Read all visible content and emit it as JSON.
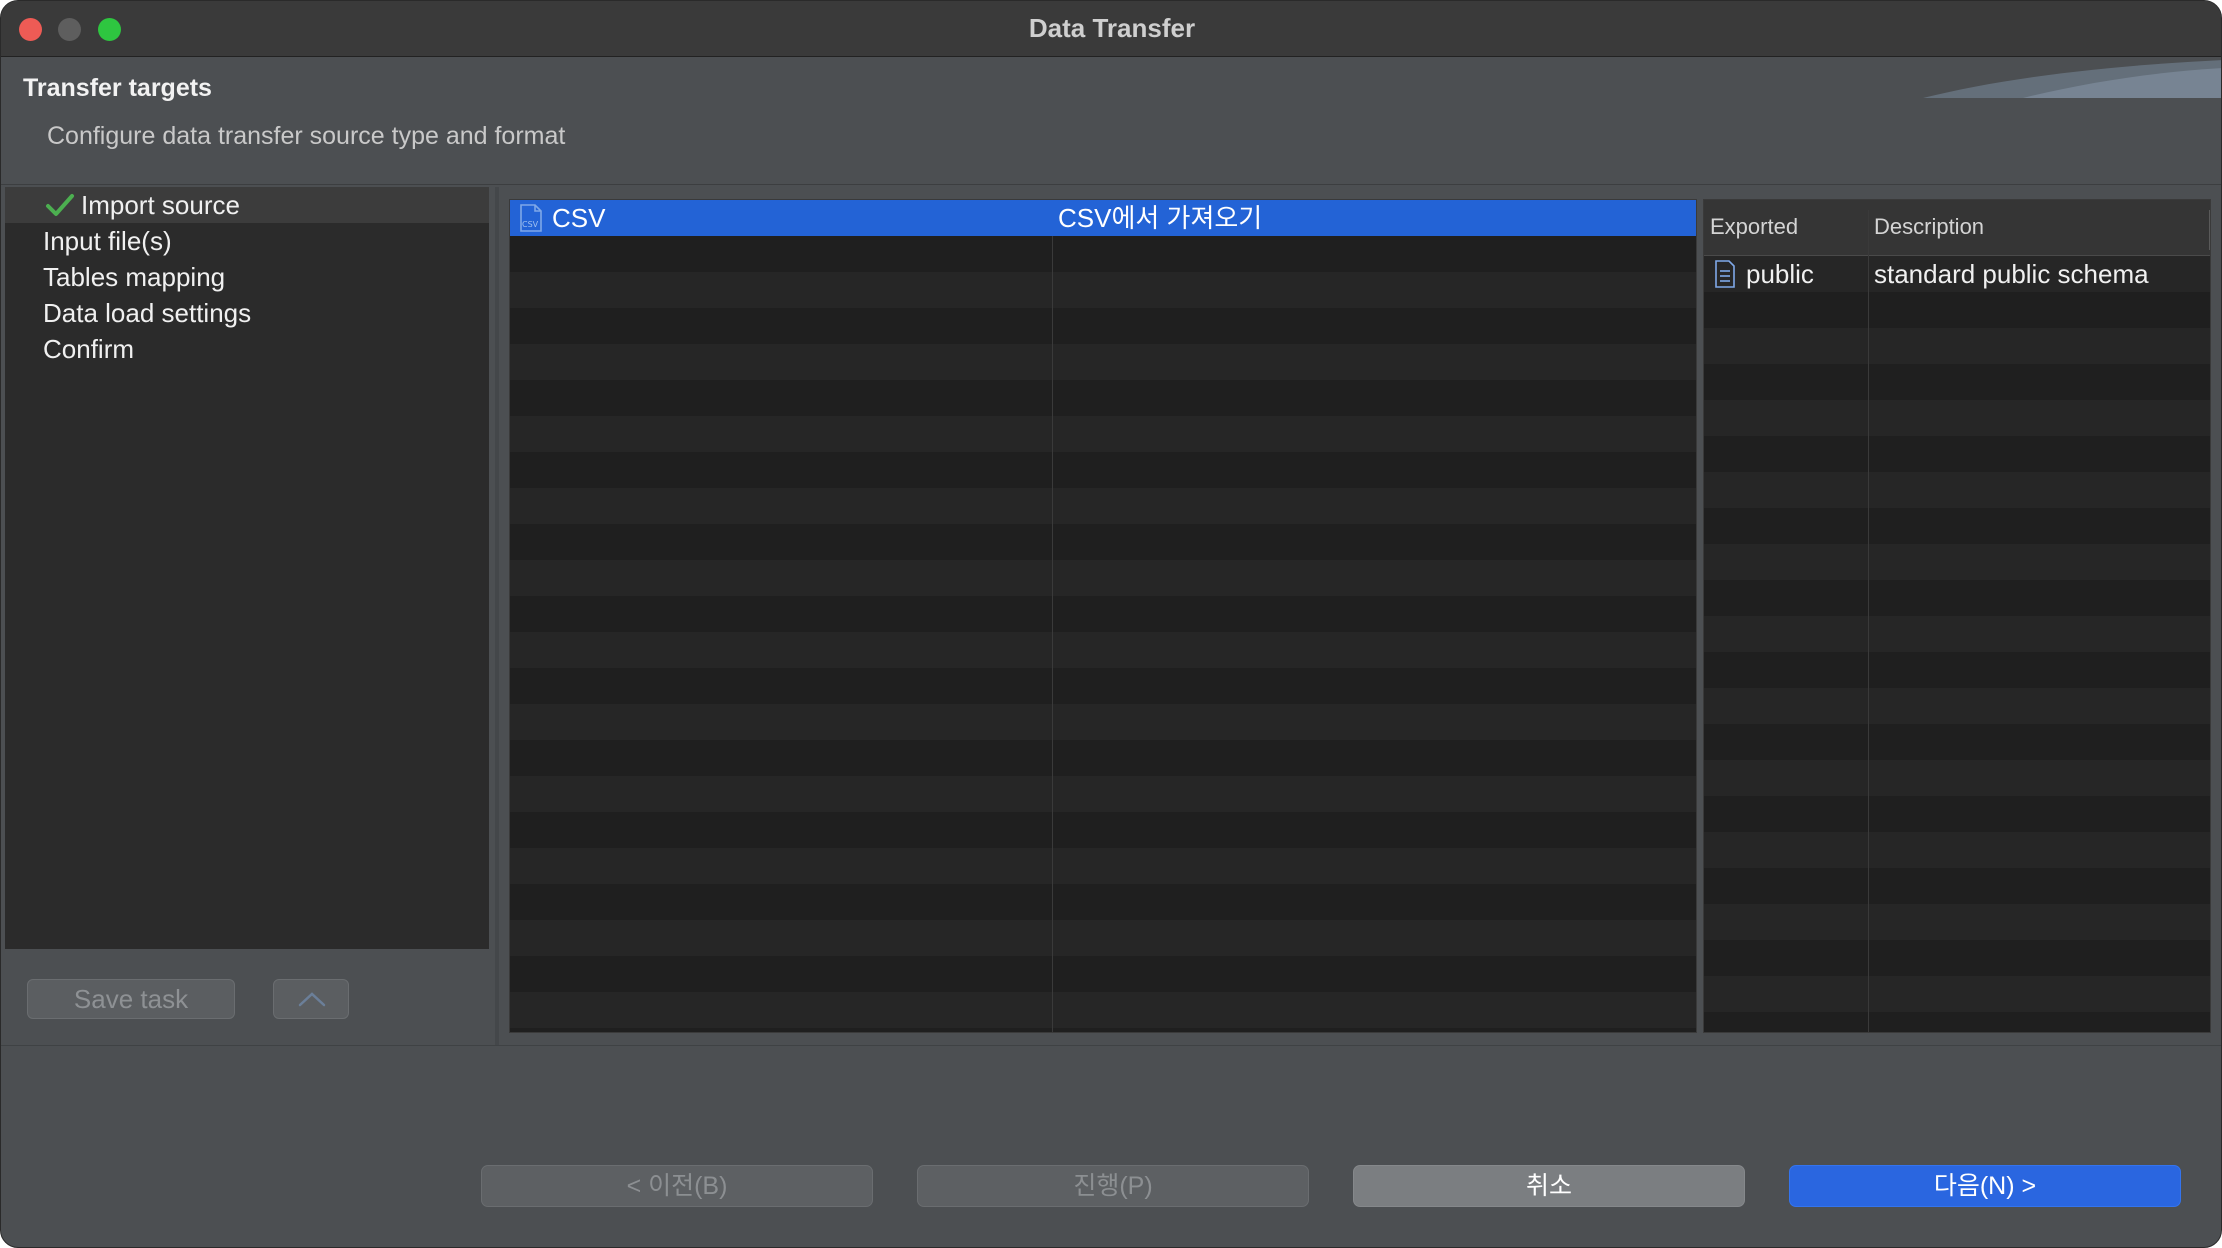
{
  "window": {
    "title": "Data Transfer"
  },
  "header": {
    "title": "Transfer targets",
    "description": "Configure data transfer source type and format"
  },
  "nav": {
    "items": [
      {
        "label": "Import source",
        "selected": true,
        "completed": true
      },
      {
        "label": "Input file(s)"
      },
      {
        "label": "Tables mapping"
      },
      {
        "label": "Data load settings"
      },
      {
        "label": "Confirm"
      }
    ],
    "save_task_label": "Save task"
  },
  "sources": {
    "rows": [
      {
        "name": "CSV",
        "description": "CSV에서 가져오기",
        "icon": "csv-file-icon",
        "selected": true
      }
    ]
  },
  "schemas": {
    "columns": [
      "Exported",
      "Description"
    ],
    "rows": [
      {
        "name": "public",
        "description": "standard public schema",
        "icon": "schema-icon"
      }
    ]
  },
  "buttons": {
    "prev": "< 이전(B)",
    "proceed": "진행(P)",
    "cancel": "취소",
    "next": "다음(N) >"
  },
  "colors": {
    "selection": "#2363d6",
    "primary_button": "#2a66e0",
    "check": "#4caf50"
  }
}
